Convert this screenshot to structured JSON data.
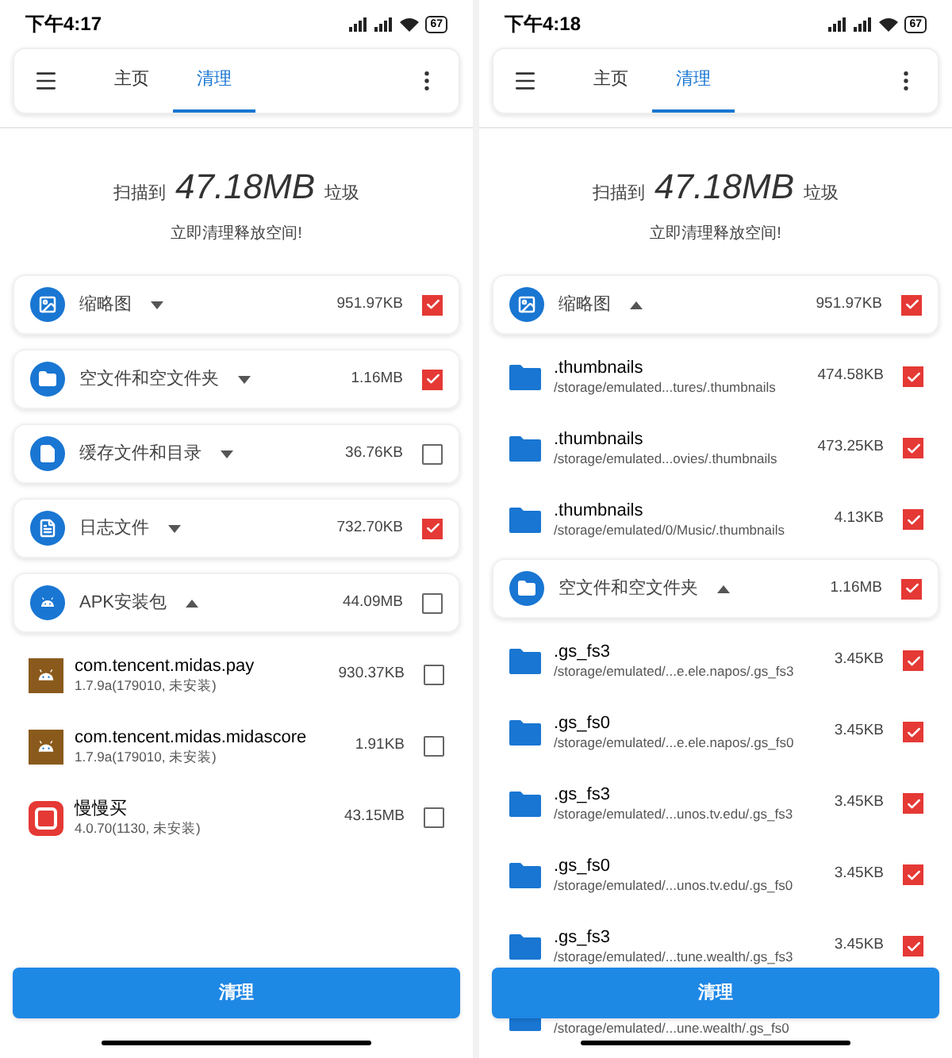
{
  "screens": [
    {
      "status_bar": {
        "time": "下午4:17",
        "battery": "67"
      },
      "tabs": [
        {
          "label": "主页",
          "selected": false
        },
        {
          "label": "清理",
          "selected": true
        }
      ],
      "summary": {
        "prefix": "扫描到",
        "amount": "47.18MB",
        "suffix": "垃圾",
        "subtitle": "立即清理释放空间!"
      },
      "groups": [
        {
          "kind": "image",
          "title": "缩略图",
          "expanded": false,
          "size": "951.97KB",
          "checked": true
        },
        {
          "kind": "folder",
          "title": "空文件和空文件夹",
          "expanded": false,
          "size": "1.16MB",
          "checked": true
        },
        {
          "kind": "file",
          "title": "缓存文件和目录",
          "expanded": false,
          "size": "36.76KB",
          "checked": false
        },
        {
          "kind": "log",
          "title": "日志文件",
          "expanded": false,
          "size": "732.70KB",
          "checked": true
        },
        {
          "kind": "android",
          "title": "APK安装包",
          "expanded": true,
          "size": "44.09MB",
          "checked": false,
          "children": [
            {
              "kind": "apk",
              "name": "com.tencent.midas.pay",
              "detail": "1.7.9a(179010, 未安装)",
              "size": "930.37KB",
              "checked": false
            },
            {
              "kind": "apk",
              "name": "com.tencent.midas.midascore",
              "detail": "1.7.9a(179010, 未安装)",
              "size": "1.91KB",
              "checked": false
            },
            {
              "kind": "app",
              "name": "慢慢买",
              "detail": "4.0.70(1130, 未安装)",
              "size": "43.15MB",
              "checked": false
            }
          ]
        }
      ],
      "button": "清理"
    },
    {
      "status_bar": {
        "time": "下午4:18",
        "battery": "67"
      },
      "tabs": [
        {
          "label": "主页",
          "selected": false
        },
        {
          "label": "清理",
          "selected": true
        }
      ],
      "summary": {
        "prefix": "扫描到",
        "amount": "47.18MB",
        "suffix": "垃圾",
        "subtitle": "立即清理释放空间!"
      },
      "groups": [
        {
          "kind": "image",
          "title": "缩略图",
          "expanded": true,
          "size": "951.97KB",
          "checked": true,
          "children": [
            {
              "kind": "folder",
              "name": ".thumbnails",
              "detail": "/storage/emulated...tures/.thumbnails",
              "size": "474.58KB",
              "checked": true
            },
            {
              "kind": "folder",
              "name": ".thumbnails",
              "detail": "/storage/emulated...ovies/.thumbnails",
              "size": "473.25KB",
              "checked": true
            },
            {
              "kind": "folder",
              "name": ".thumbnails",
              "detail": "/storage/emulated/0/Music/.thumbnails",
              "size": "4.13KB",
              "checked": true
            }
          ]
        },
        {
          "kind": "folder",
          "title": "空文件和空文件夹",
          "expanded": true,
          "size": "1.16MB",
          "checked": true,
          "children": [
            {
              "kind": "folder",
              "name": ".gs_fs3",
              "detail": "/storage/emulated/...e.ele.napos/.gs_fs3",
              "size": "3.45KB",
              "checked": true
            },
            {
              "kind": "folder",
              "name": ".gs_fs0",
              "detail": "/storage/emulated/...e.ele.napos/.gs_fs0",
              "size": "3.45KB",
              "checked": true
            },
            {
              "kind": "folder",
              "name": ".gs_fs3",
              "detail": "/storage/emulated/...unos.tv.edu/.gs_fs3",
              "size": "3.45KB",
              "checked": true
            },
            {
              "kind": "folder",
              "name": ".gs_fs0",
              "detail": "/storage/emulated/...unos.tv.edu/.gs_fs0",
              "size": "3.45KB",
              "checked": true
            },
            {
              "kind": "folder",
              "name": ".gs_fs3",
              "detail": "/storage/emulated/...tune.wealth/.gs_fs3",
              "size": "3.45KB",
              "checked": true
            },
            {
              "kind": "folder",
              "detail": "/storage/emulated/...une.wealth/.gs_fs0"
            }
          ]
        }
      ],
      "button": "清理"
    }
  ]
}
